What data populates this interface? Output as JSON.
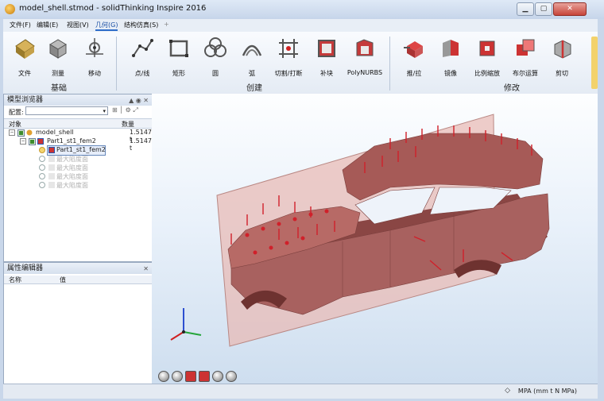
{
  "window": {
    "title": "model_shell.stmod - solidThinking Inspire 2016"
  },
  "menu": [
    {
      "key": "file",
      "label": "文件(F)"
    },
    {
      "key": "edit",
      "label": "编辑(E)"
    },
    {
      "key": "view",
      "label": "视图(V)"
    },
    {
      "key": "geometry",
      "label": "几何(G)",
      "active": true
    },
    {
      "key": "struct",
      "label": "结构仿真(S)"
    },
    {
      "key": "add",
      "label": "+"
    }
  ],
  "ribbon": {
    "buttons": [
      {
        "label": "文件",
        "icon": "file-icon"
      },
      {
        "label": "测量",
        "icon": "measure-icon"
      },
      {
        "label": "移动",
        "icon": "move-icon"
      },
      {
        "label": "点/线",
        "icon": "point-line-icon"
      },
      {
        "label": "矩形",
        "icon": "rectangle-icon"
      },
      {
        "label": "圆",
        "icon": "circle-icon"
      },
      {
        "label": "弧",
        "icon": "arc-icon"
      },
      {
        "label": "切割/打断",
        "icon": "cut-break-icon"
      },
      {
        "label": "补块",
        "icon": "patch-icon"
      },
      {
        "label": "PolyNURBS",
        "icon": "polynurbs-icon"
      },
      {
        "label": "推/拉",
        "icon": "push-pull-icon"
      },
      {
        "label": "镜像",
        "icon": "mirror-icon"
      },
      {
        "label": "比例缩放",
        "icon": "scale-icon"
      },
      {
        "label": "布尔运算",
        "icon": "boolean-icon"
      },
      {
        "label": "剪切",
        "icon": "trim-icon"
      }
    ],
    "groups": [
      {
        "label": "基础"
      },
      {
        "label": "创建"
      },
      {
        "label": "修改"
      }
    ]
  },
  "model_browser": {
    "title": "模型浏览器",
    "config_label": "配置:",
    "columns": {
      "object": "对象",
      "quantity": "数量"
    },
    "rows": [
      {
        "name": "model_shell",
        "value": "1.5147 t"
      },
      {
        "name": "Part1_st1_fem2",
        "value": "1.5147 t"
      },
      {
        "name": "Part1_st1_fem2",
        "value": ""
      },
      {
        "name": "最大陷度面",
        "value": ""
      },
      {
        "name": "最大陷度面",
        "value": ""
      },
      {
        "name": "最大陷度面",
        "value": ""
      },
      {
        "name": "最大陷度面",
        "value": ""
      }
    ]
  },
  "property_editor": {
    "title": "属性编辑器",
    "columns": {
      "name": "名称",
      "value": "值"
    }
  },
  "status": {
    "units": "MPA (mm t N MPa)"
  },
  "colors": {
    "model": "#a8615f",
    "load_arrow": "#d0202a",
    "plane": "#e8b8b2"
  }
}
